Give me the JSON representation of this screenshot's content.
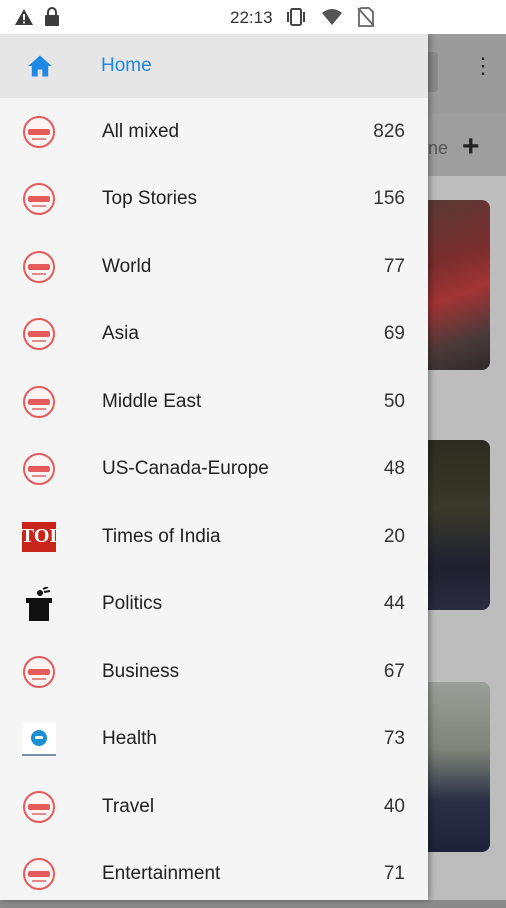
{
  "statusbar": {
    "time": "22:13",
    "left_icons": [
      "warning-icon",
      "lock-icon"
    ],
    "right_icons": [
      "vibrate-icon",
      "wifi-icon",
      "no-sim-icon"
    ]
  },
  "drawer": {
    "home": {
      "label": "Home",
      "icon": "home-icon",
      "color": "#1e88e5"
    },
    "items": [
      {
        "label": "All mixed",
        "count": "826",
        "icon": "news-logo-icon"
      },
      {
        "label": "Top Stories",
        "count": "156",
        "icon": "news-logo-icon"
      },
      {
        "label": "World",
        "count": "77",
        "icon": "news-logo-icon"
      },
      {
        "label": "Asia",
        "count": "69",
        "icon": "news-logo-icon"
      },
      {
        "label": "Middle East",
        "count": "50",
        "icon": "news-logo-icon"
      },
      {
        "label": "US-Canada-Europe",
        "count": "48",
        "icon": "news-logo-icon"
      },
      {
        "label": "Times of India",
        "count": "20",
        "icon": "toi-logo-icon",
        "logo_text": "TOI"
      },
      {
        "label": "Politics",
        "count": "44",
        "icon": "podium-icon"
      },
      {
        "label": "Business",
        "count": "67",
        "icon": "news-logo-icon"
      },
      {
        "label": "Health",
        "count": "73",
        "icon": "health-logo-icon"
      },
      {
        "label": "Travel",
        "count": "40",
        "icon": "news-logo-icon"
      },
      {
        "label": "Entertainment",
        "count": "71",
        "icon": "news-logo-icon"
      }
    ]
  },
  "background": {
    "tab_partial_text": "ne",
    "add_icon": "plus-icon",
    "menu_icon": "more-vert-icon"
  }
}
